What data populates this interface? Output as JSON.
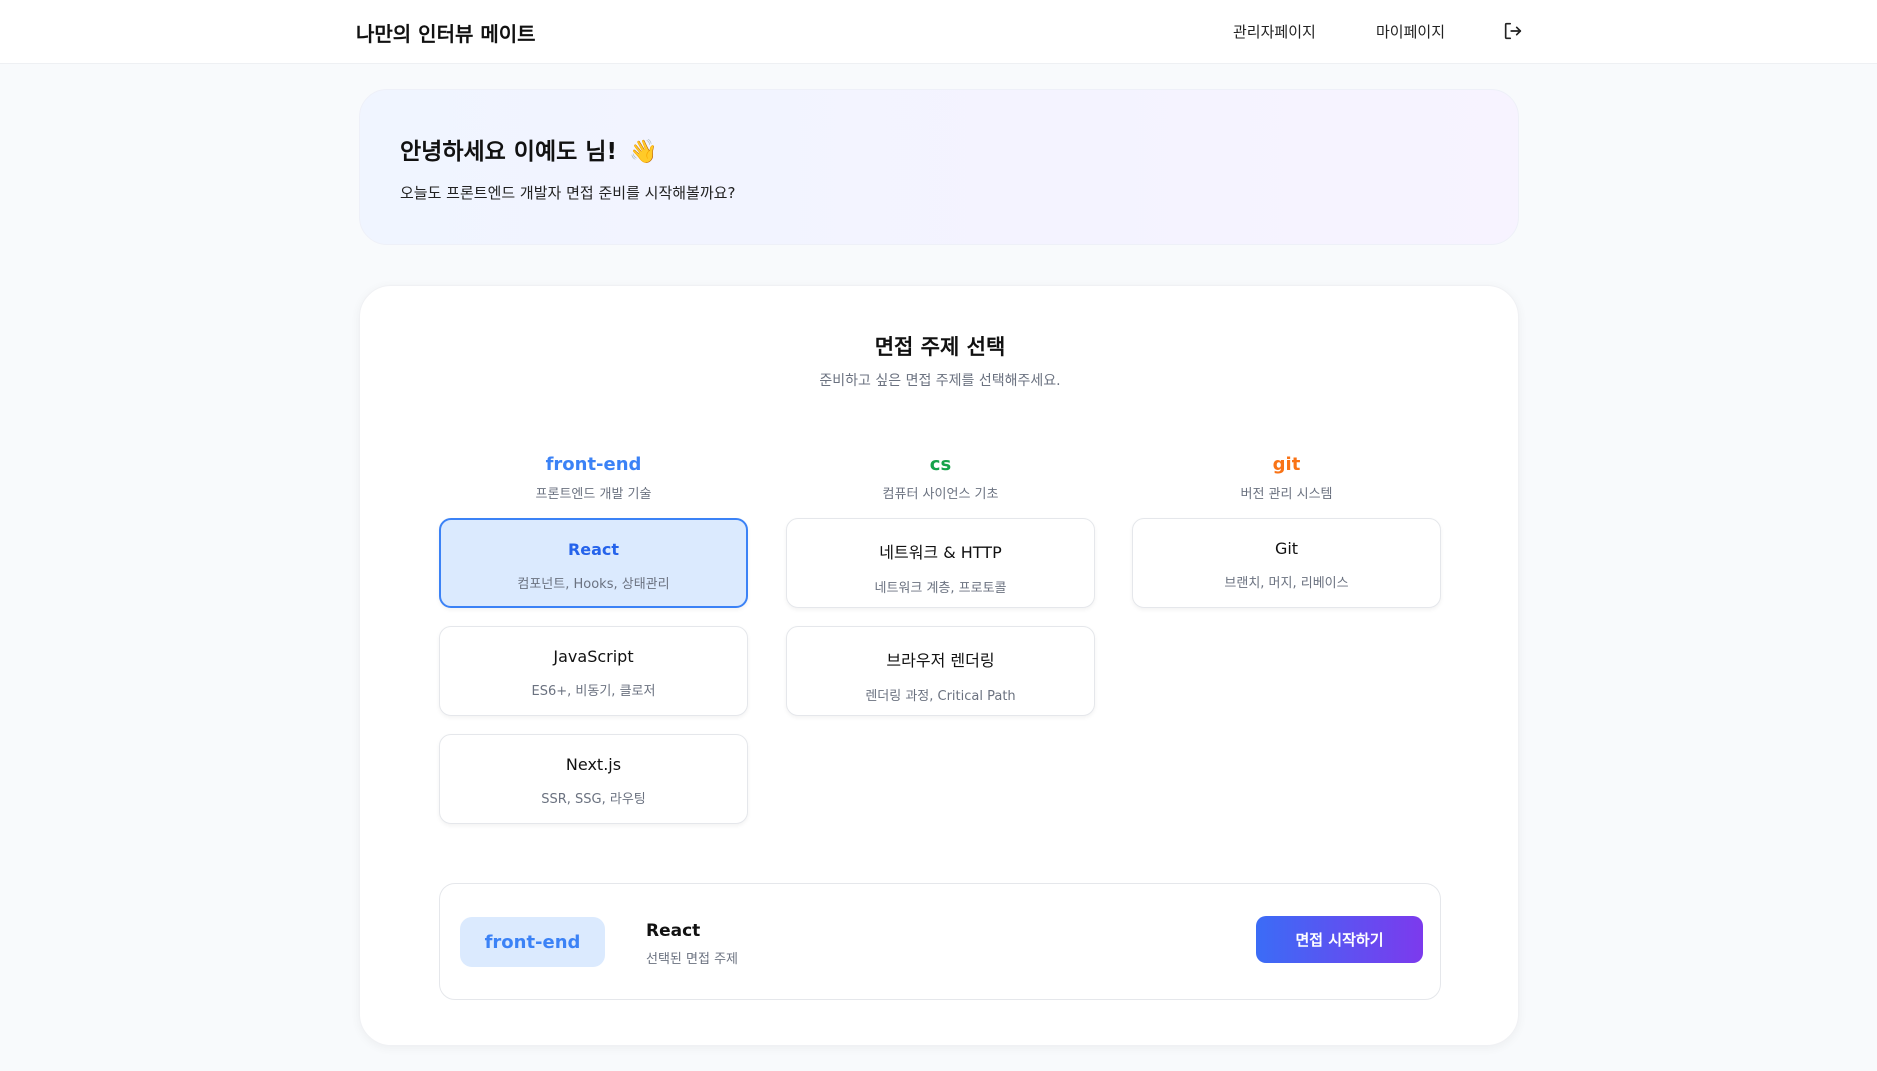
{
  "header": {
    "brand": "나만의 인터뷰 메이트",
    "nav": {
      "admin": "관리자페이지",
      "mypage": "마이페이지"
    },
    "logout_icon": "logout-icon"
  },
  "welcome": {
    "title": "안녕하세요 이예도 님!",
    "emoji": "👋",
    "subtitle": "오늘도 프론트엔드 개발자 면접 준비를 시작해볼까요?"
  },
  "topic_select": {
    "title": "면접 주제 선택",
    "subtitle": "준비하고 싶은 면접 주제를 선택해주세요.",
    "categories": [
      {
        "name": "front-end",
        "desc": "프론트엔드 개발 기술",
        "color": "#3b82f6",
        "topics": [
          {
            "name": "React",
            "desc": "컴포넌트, Hooks, 상태관리",
            "selected": true
          },
          {
            "name": "JavaScript",
            "desc": "ES6+, 비동기, 클로저",
            "selected": false
          },
          {
            "name": "Next.js",
            "desc": "SSR, SSG, 라우팅",
            "selected": false
          }
        ]
      },
      {
        "name": "cs",
        "desc": "컴퓨터 사이언스 기초",
        "color": "#16a34a",
        "topics": [
          {
            "name": "네트워크 & HTTP",
            "desc": "네트워크 계층, 프로토콜",
            "selected": false
          },
          {
            "name": "브라우저 렌더링",
            "desc": "렌더링 과정, Critical Path",
            "selected": false
          }
        ]
      },
      {
        "name": "git",
        "desc": "버전 관리 시스템",
        "color": "#f97316",
        "topics": [
          {
            "name": "Git",
            "desc": "브랜치, 머지, 리베이스",
            "selected": false
          }
        ]
      }
    ]
  },
  "selection": {
    "category": "front-end",
    "topic": "React",
    "caption": "선택된 면접 주제",
    "start_label": "면접 시작하기"
  }
}
